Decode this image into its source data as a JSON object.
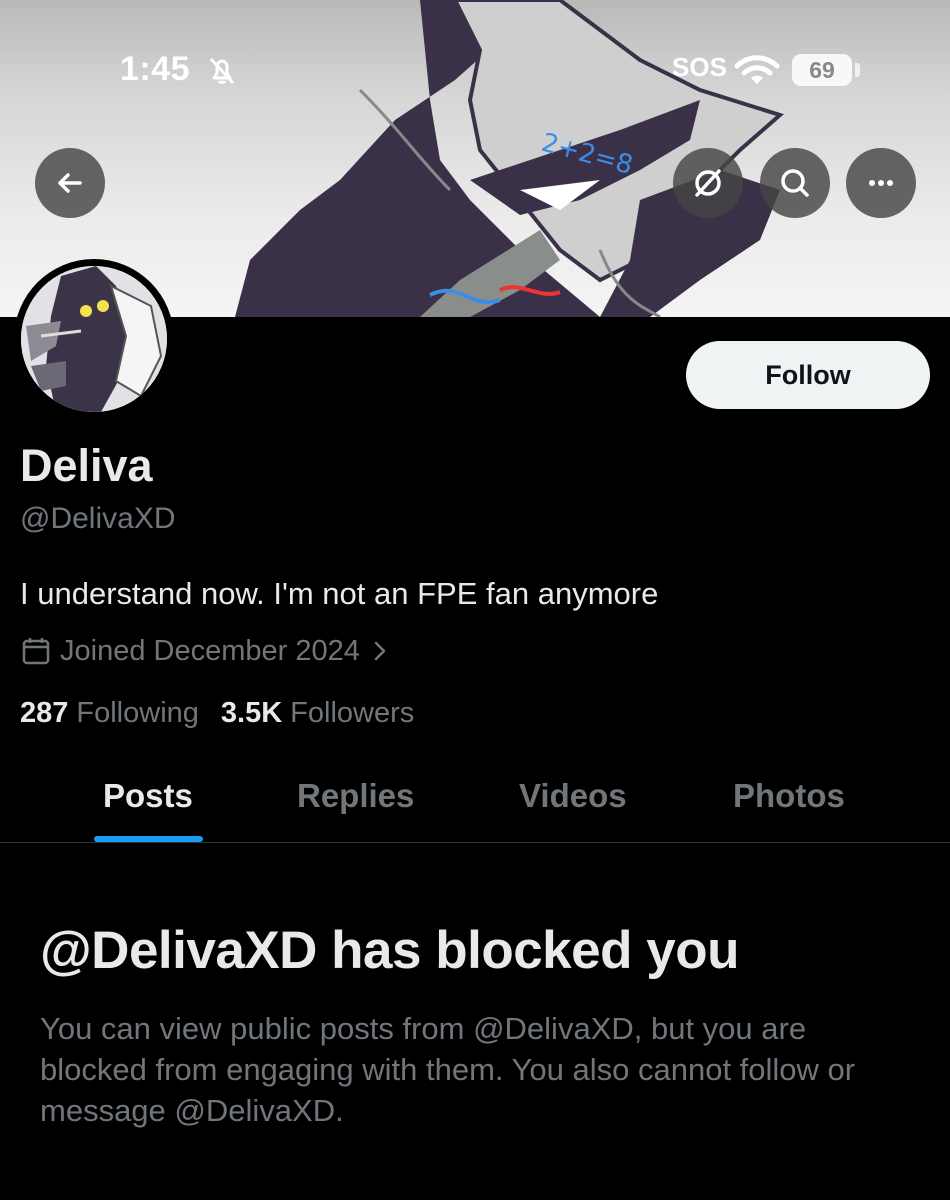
{
  "status_bar": {
    "time": "1:45",
    "carrier": "SOS",
    "battery": "69",
    "icons": [
      "bell-slash-icon",
      "wifi-icon",
      "battery-icon"
    ]
  },
  "header": {
    "icons": [
      "back-arrow-icon",
      "circle-slash-icon",
      "search-icon",
      "more-icon"
    ],
    "banner_text": "2+2=8"
  },
  "profile": {
    "follow_label": "Follow",
    "display_name": "Deliva",
    "handle": "@DelivaXD",
    "bio": "I understand now. I'm not an FPE fan anymore",
    "joined": "Joined December 2024",
    "following_count": "287",
    "following_label": "Following",
    "followers_count": "3.5K",
    "followers_label": "Followers"
  },
  "tabs": [
    {
      "label": "Posts",
      "active": true
    },
    {
      "label": "Replies",
      "active": false
    },
    {
      "label": "Videos",
      "active": false
    },
    {
      "label": "Photos",
      "active": false
    }
  ],
  "blocked": {
    "title": "@DelivaXD has blocked you",
    "description": "You can view public posts from @DelivaXD, but you are blocked from engaging with them. You also cannot follow or message @DelivaXD."
  },
  "colors": {
    "background": "#000000",
    "text_primary": "#e7e9ea",
    "text_secondary": "#71767b",
    "accent": "#1d9bf0",
    "follow_button": "#eff3f4"
  }
}
